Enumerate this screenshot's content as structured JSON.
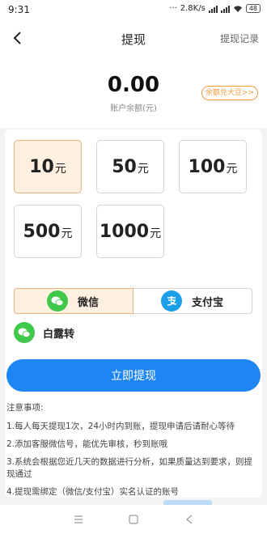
{
  "status_bar": {
    "time": "9:31",
    "network_speed": "2.8K/s",
    "battery": "48",
    "icons": [
      "dots-icon",
      "signal-icon",
      "wifi-icon",
      "battery-icon"
    ]
  },
  "nav": {
    "back_icon": "chevron-left-icon",
    "title": "提现",
    "records_link": "提现记录"
  },
  "balance": {
    "amount": "0.00",
    "label": "账户余额(元)",
    "exchange_button": "余额兑大豆>>"
  },
  "amount_options": [
    {
      "value": "10",
      "unit": "元",
      "selected": true
    },
    {
      "value": "50",
      "unit": "元",
      "selected": false
    },
    {
      "value": "100",
      "unit": "元",
      "selected": false
    },
    {
      "value": "500",
      "unit": "元",
      "selected": false
    },
    {
      "value": "1000",
      "unit": "元",
      "selected": false
    }
  ],
  "payment_methods": [
    {
      "label": "微信",
      "icon": "wechat-icon",
      "selected": true
    },
    {
      "label": "支付宝",
      "icon": "alipay-icon",
      "selected": false
    }
  ],
  "account": {
    "icon": "wechat-icon",
    "name": "白露转"
  },
  "submit_button": "立即提现",
  "notes": {
    "heading": "注意事项:",
    "items": [
      "1.每人每天提现1次，24小时内到账，提现申请后请耐心等待",
      "2.添加客服微信号，能优先审核，秒到账哦",
      "3.系统会根据您近几天的数据进行分析，如果质量达到要求，则提现通过",
      "4.提现需绑定（微信/支付宝）实名认证的账号"
    ]
  },
  "colors": {
    "primary_blue": "#1e86f2",
    "selected_bg": "#fff0e0",
    "selected_border": "#f3b27a",
    "accent_orange": "#f39a3c",
    "wechat_green": "#3fc84a",
    "alipay_blue": "#1a9fe8"
  },
  "system_nav": {
    "icons": [
      "menu-icon",
      "home-icon",
      "back-icon"
    ]
  }
}
